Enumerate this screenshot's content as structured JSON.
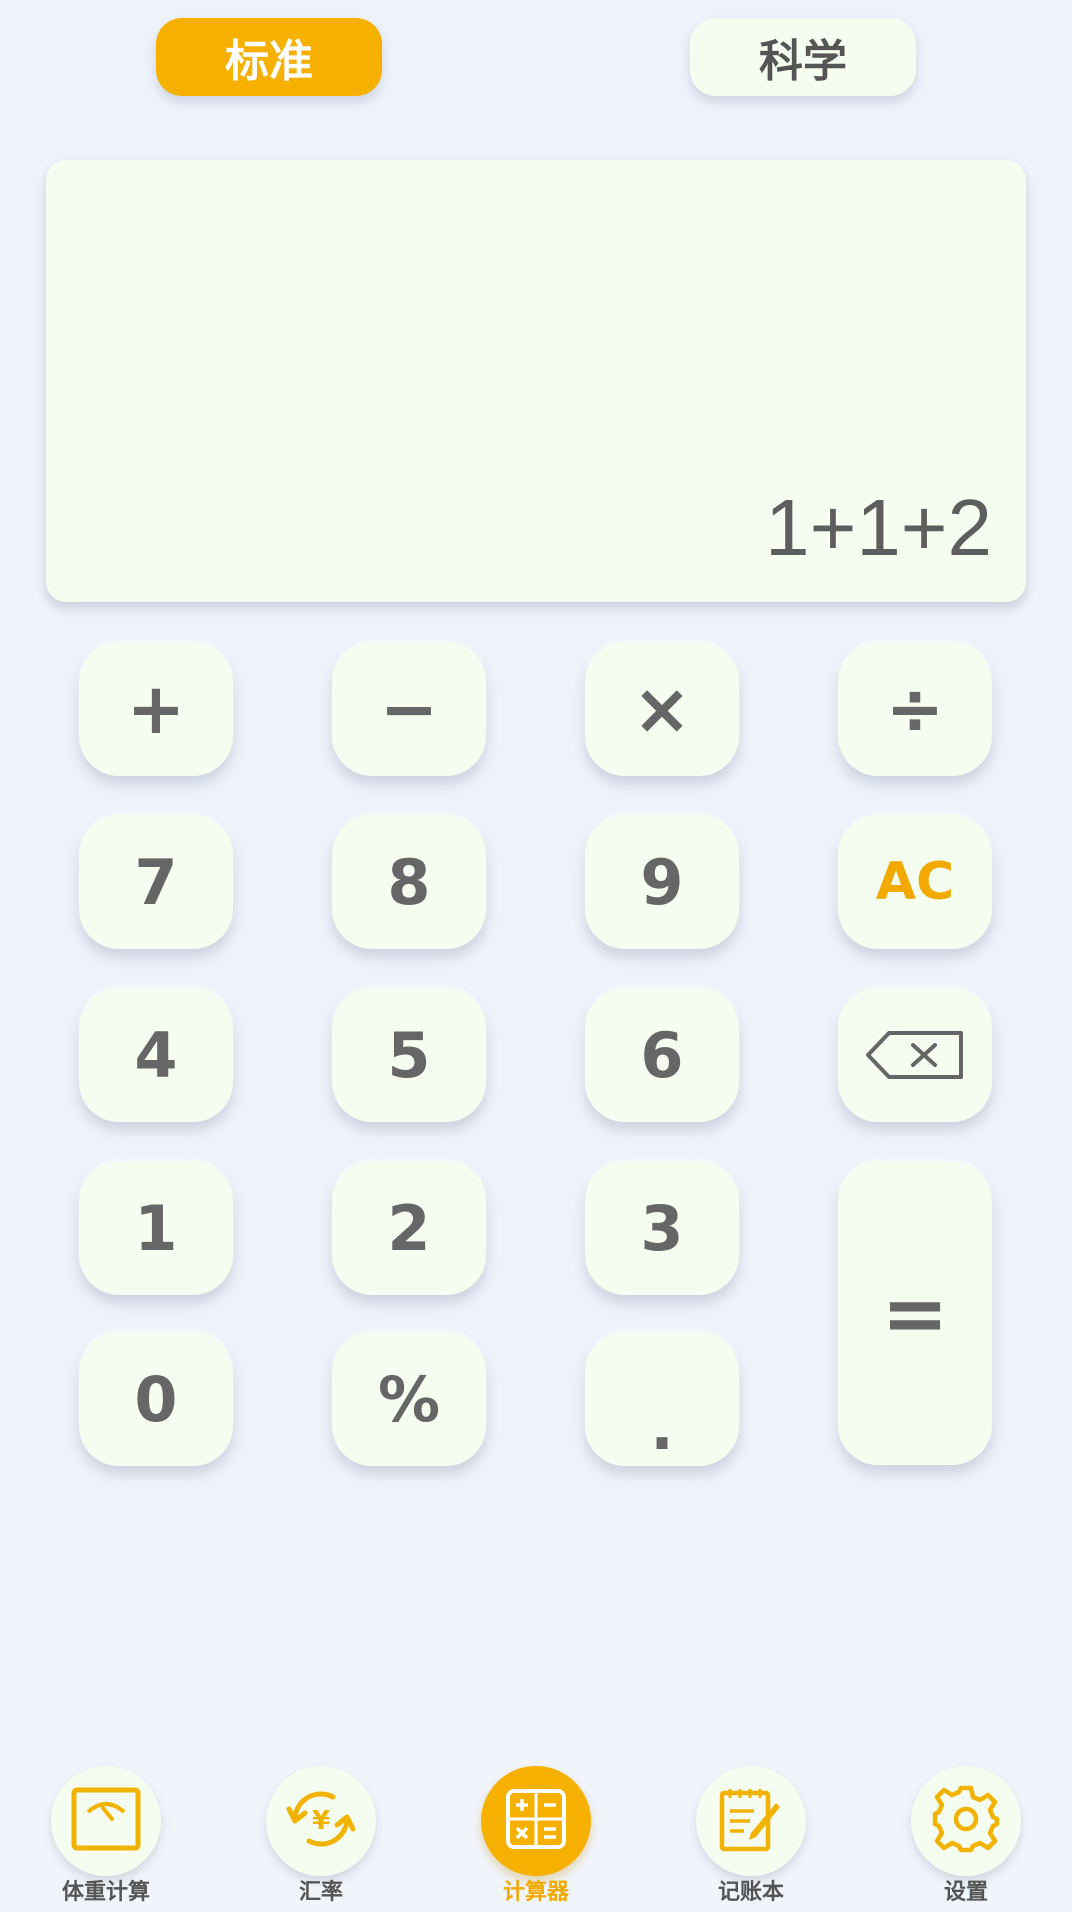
{
  "mode_tabs": {
    "standard": "标准",
    "scientific": "科学"
  },
  "display": {
    "expression": "1+1+2"
  },
  "keypad": {
    "plus": "+",
    "minus": "−",
    "multiply": "×",
    "divide": "÷",
    "seven": "7",
    "eight": "8",
    "nine": "9",
    "clear": "AC",
    "four": "4",
    "five": "5",
    "six": "6",
    "backspace_icon": "backspace-icon",
    "one": "1",
    "two": "2",
    "three": "3",
    "equals": "=",
    "zero": "0",
    "percent": "%",
    "decimal": "."
  },
  "bottom_nav": {
    "items": [
      {
        "label": "体重计算",
        "icon": "scale-icon"
      },
      {
        "label": "汇率",
        "icon": "currency-exchange-icon"
      },
      {
        "label": "计算器",
        "icon": "calculator-icon"
      },
      {
        "label": "记账本",
        "icon": "notebook-icon"
      },
      {
        "label": "设置",
        "icon": "gear-icon"
      }
    ],
    "active_index": 2
  },
  "colors": {
    "accent": "#f6b000",
    "key_background": "#f4fdef",
    "page_background": "#edf2fb",
    "key_text": "#666666"
  }
}
